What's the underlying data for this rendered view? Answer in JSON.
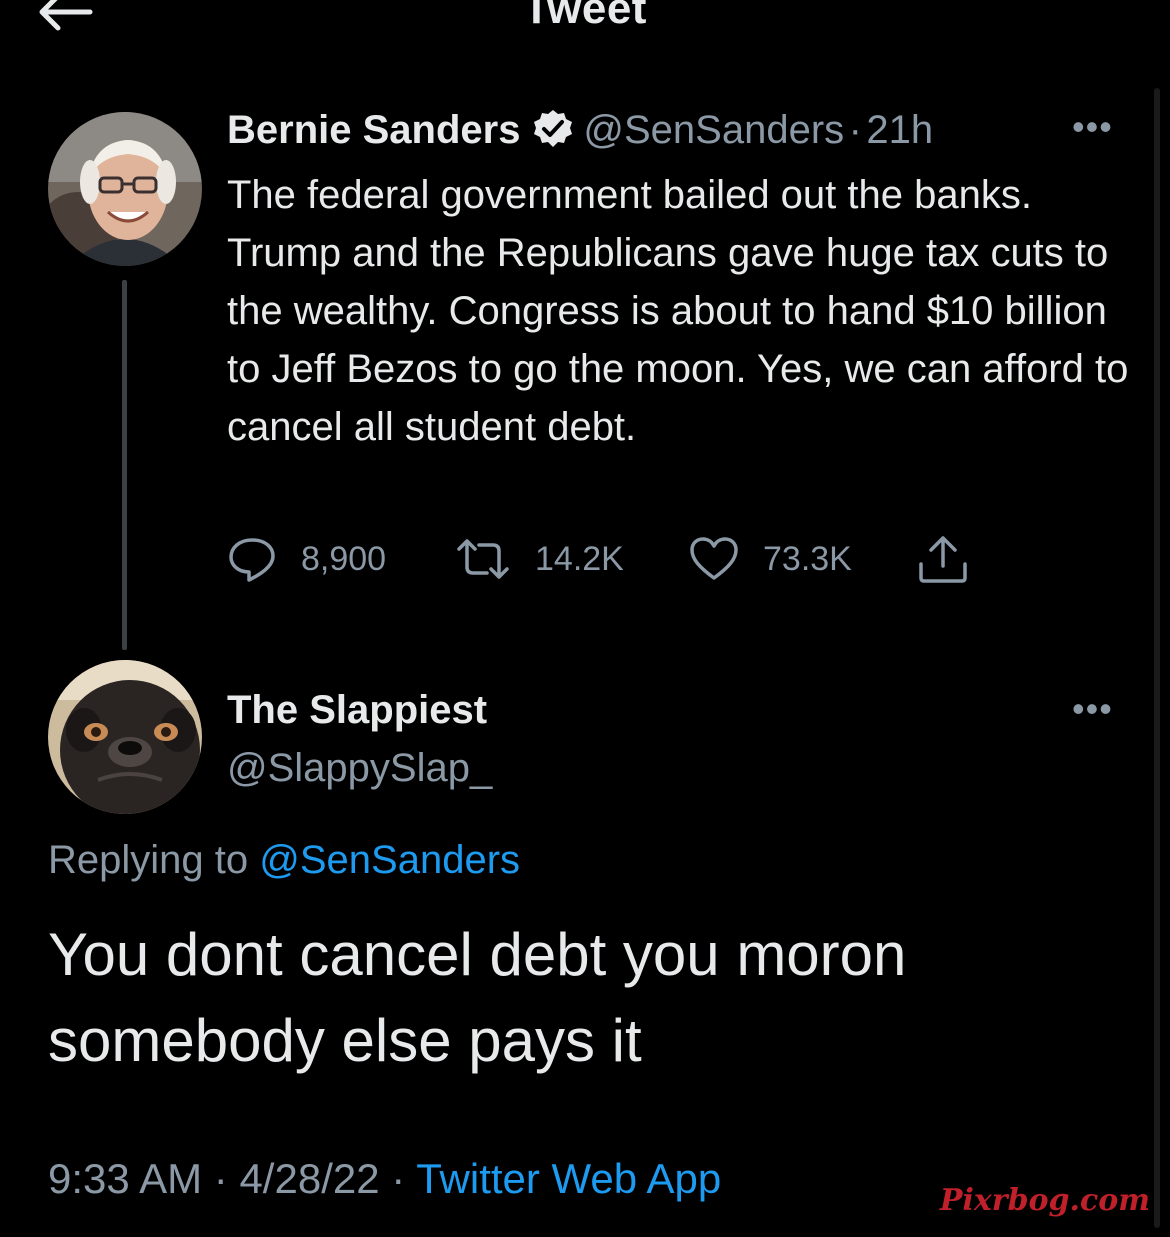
{
  "header": {
    "title": "Tweet"
  },
  "original_tweet": {
    "name": "Bernie Sanders",
    "handle": "@SenSanders",
    "separator": "·",
    "time": "21h",
    "text": "The federal government bailed out the banks. Trump and the Republicans gave huge tax cuts to the wealthy. Congress is about to hand $10 billion to Jeff Bezos to go the moon. Yes, we can afford to cancel all student debt.",
    "replies": "8,900",
    "retweets": "14.2K",
    "likes": "73.3K",
    "more_glyph": "•••"
  },
  "reply_tweet": {
    "name": "The Slappiest",
    "handle": "@SlappySlap_",
    "replying_label": "Replying to",
    "replying_to": "@SenSanders",
    "text": "You dont cancel debt you moron somebody else pays it",
    "time": "9:33 AM",
    "date": "4/28/22",
    "separator": "·",
    "app": "Twitter Web App",
    "more_glyph": "•••"
  },
  "watermark": "Pixrbog.com",
  "colors": {
    "background": "#000000",
    "text": "#e7e9ea",
    "muted": "#8b98a5",
    "accent": "#1d9bf0"
  },
  "icons": [
    "back-arrow-icon",
    "verified-badge-icon",
    "reply-icon",
    "retweet-icon",
    "like-icon",
    "share-icon",
    "more-icon"
  ]
}
